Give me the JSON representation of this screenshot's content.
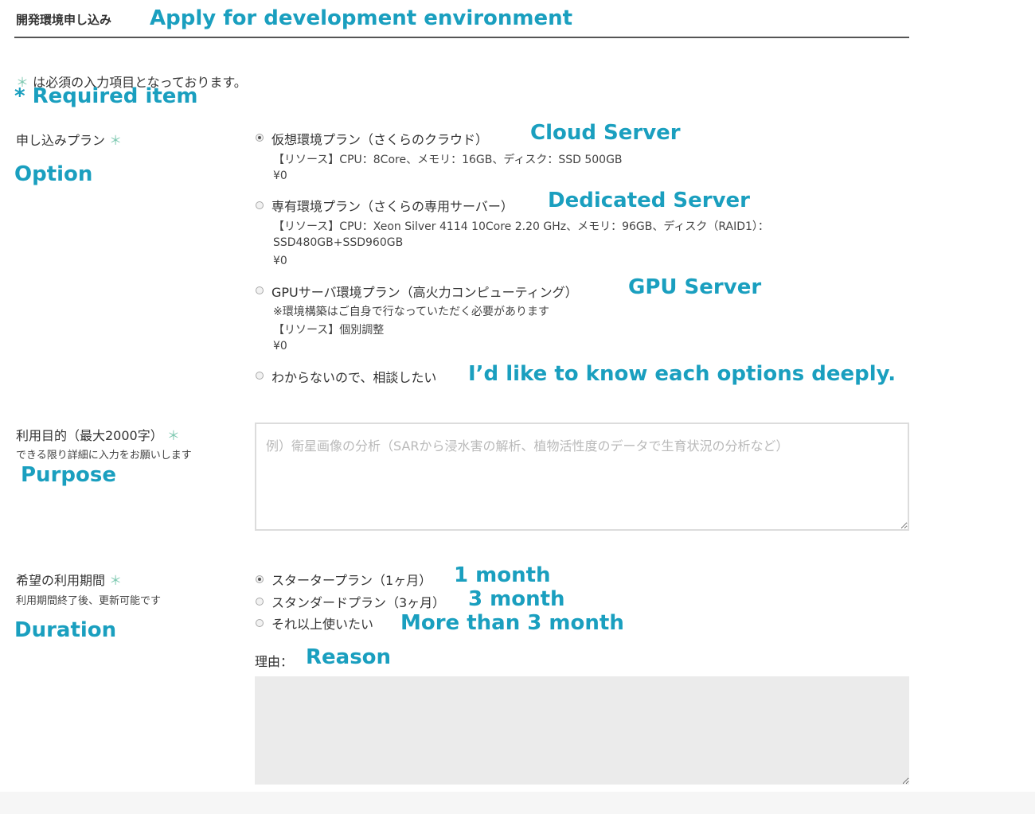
{
  "header": {
    "title_jp": "開発環境申し込み",
    "title_en": "Apply for development environment"
  },
  "required_note": {
    "star": "＊",
    "text_jp": "は必須の入力項目となっております。",
    "text_en": "* Required item"
  },
  "plan": {
    "label_jp": "申し込みプラン",
    "star": "＊",
    "label_en": "Option",
    "options": [
      {
        "label_jp": "仮想環境プラン（さくらのクラウド）",
        "label_en": "Cloud Server",
        "detail1": "【リソース】CPU：8Core、メモリ：16GB、ディスク：SSD 500GB",
        "price": "¥0",
        "checked": true
      },
      {
        "label_jp": "専有環境プラン（さくらの専用サーバー）",
        "label_en": "Dedicated Server",
        "detail1": "【リソース】CPU：Xeon Silver 4114 10Core 2.20 GHz、メモリ：96GB、ディスク（RAID1）：",
        "detail2": "SSD480GB+SSD960GB",
        "price": "¥0",
        "checked": false
      },
      {
        "label_jp": "GPUサーバ環境プラン（高火力コンピューティング）",
        "label_en": "GPU Server",
        "detail1": "※環境構築はご自身で行なっていただく必要があります",
        "detail2": "【リソース】個別調整",
        "price": "¥0",
        "checked": false
      },
      {
        "label_jp": "わからないので、相談したい",
        "label_en": "I’d like to know each options deeply.",
        "checked": false
      }
    ]
  },
  "purpose": {
    "label_jp": "利用目的（最大2000字）",
    "star": "＊",
    "sub_jp": "できる限り詳細に入力をお願いします",
    "label_en": "Purpose",
    "placeholder": "例）衛星画像の分析（SARから浸水害の解析、植物活性度のデータで生育状況の分析など）",
    "value": ""
  },
  "duration": {
    "label_jp": "希望の利用期間",
    "star": "＊",
    "sub_jp": "利用期間終了後、更新可能です",
    "label_en": "Duration",
    "options": [
      {
        "label_jp": "スタータープラン（1ヶ月）",
        "label_en": "1 month",
        "checked": true
      },
      {
        "label_jp": "スタンダードプラン（3ヶ月）",
        "label_en": "3 month",
        "checked": false
      },
      {
        "label_jp": "それ以上使いたい",
        "label_en": "More than 3 month",
        "checked": false
      }
    ],
    "reason_label_jp": "理由：",
    "reason_label_en": "Reason",
    "reason_value": ""
  },
  "colors": {
    "annotation": "#1a9fbf",
    "required_star": "#7dc8b0",
    "header_rule": "#555555",
    "disabled_field_bg": "#ebebeb"
  }
}
